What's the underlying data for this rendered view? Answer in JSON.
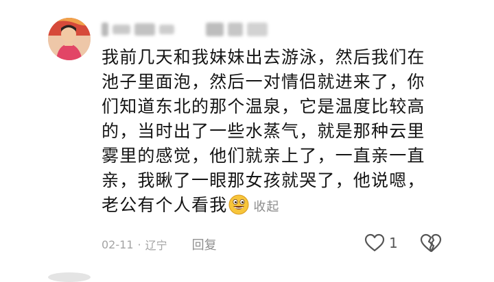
{
  "comment": {
    "lines": [
      "我前几天和我妹妹出去游泳，然后我们在",
      "池子里面泡，然后一对情侣就进来了，你",
      "们知道东北的那个温泉，它是温度比较高",
      "的，当时出了一些水蒸气，就是那种云里",
      "雾里的感觉，他们就亲上了，一直亲一直",
      "亲，我瞅了一眼那女孩就哭了，他说嗯，",
      "老公有个人看我"
    ],
    "emoji": "grinning-face-emoji",
    "collapse_label": "收起"
  },
  "meta": {
    "date": "02-11",
    "separator": "·",
    "location": "辽宁",
    "reply_label": "回复"
  },
  "actions": {
    "like_count": "1"
  },
  "icons": {
    "like": "heart-icon",
    "dislike": "broken-heart-icon"
  }
}
